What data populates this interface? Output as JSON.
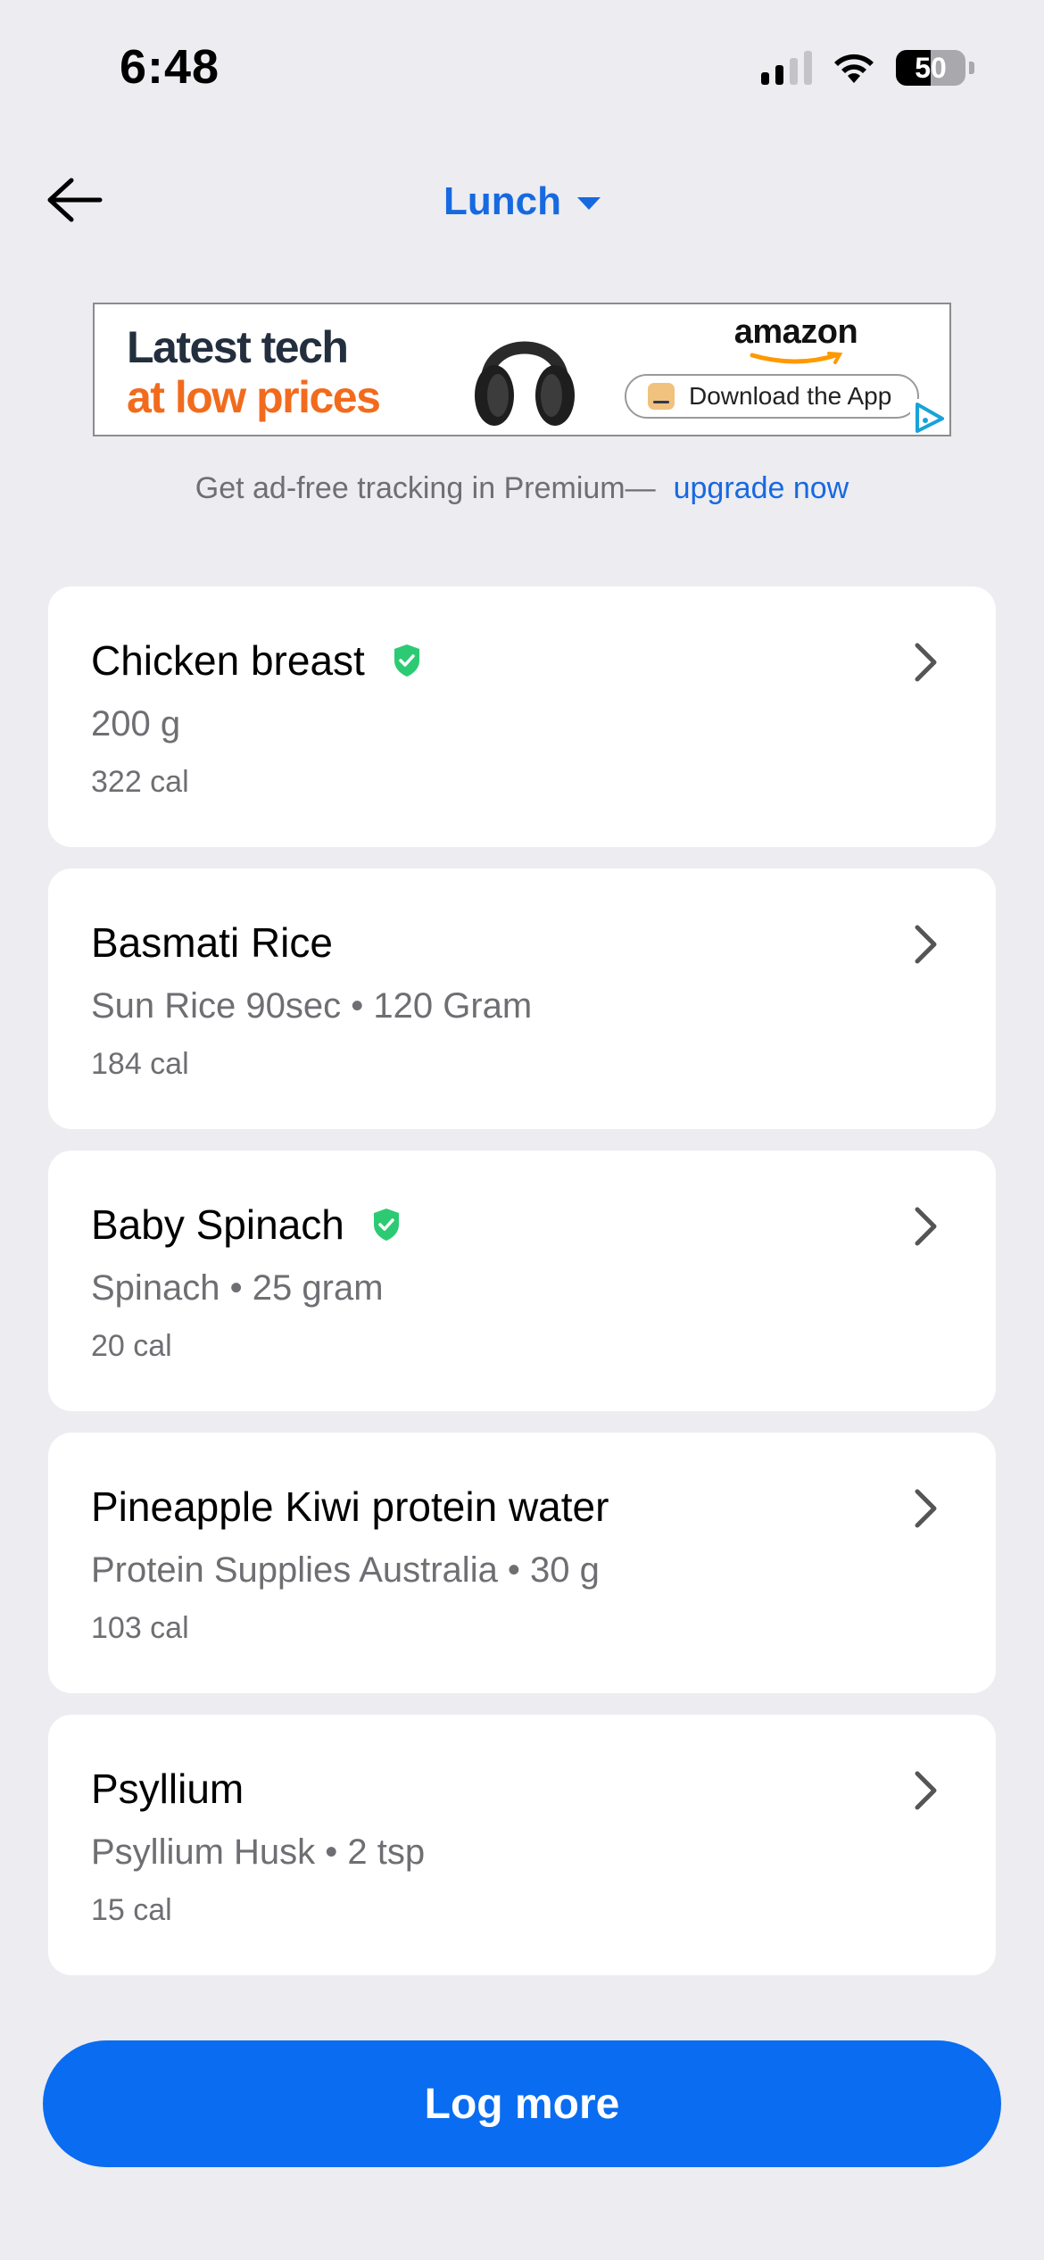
{
  "status_bar": {
    "time": "6:48",
    "battery": "50",
    "battery_level": 0.5
  },
  "header": {
    "meal_title": "Lunch",
    "accent_color": "#1769E0"
  },
  "ad": {
    "headline_line1": "Latest tech",
    "headline_line2": "at low prices",
    "brand": "amazon",
    "cta": "Download the App"
  },
  "premium_note": {
    "text": "Get ad-free tracking in Premium—",
    "link": "upgrade now"
  },
  "foods": [
    {
      "name": "Chicken breast",
      "verified": true,
      "detail": "200 g",
      "calories": "322 cal"
    },
    {
      "name": "Basmati Rice",
      "verified": false,
      "detail": "Sun Rice 90sec • 120 Gram",
      "calories": "184 cal"
    },
    {
      "name": "Baby Spinach",
      "verified": true,
      "detail": "Spinach • 25 gram",
      "calories": "20 cal"
    },
    {
      "name": "Pineapple Kiwi protein water",
      "verified": false,
      "detail": "Protein Supplies Australia • 30 g",
      "calories": "103 cal"
    },
    {
      "name": "Psyllium",
      "verified": false,
      "detail": "Psyllium Husk • 2 tsp",
      "calories": "15 cal"
    }
  ],
  "log_more_button": "Log more",
  "colors": {
    "background": "#ECECF1",
    "primary_button": "#0A6CF0",
    "verified_badge": "#2CCB73"
  }
}
